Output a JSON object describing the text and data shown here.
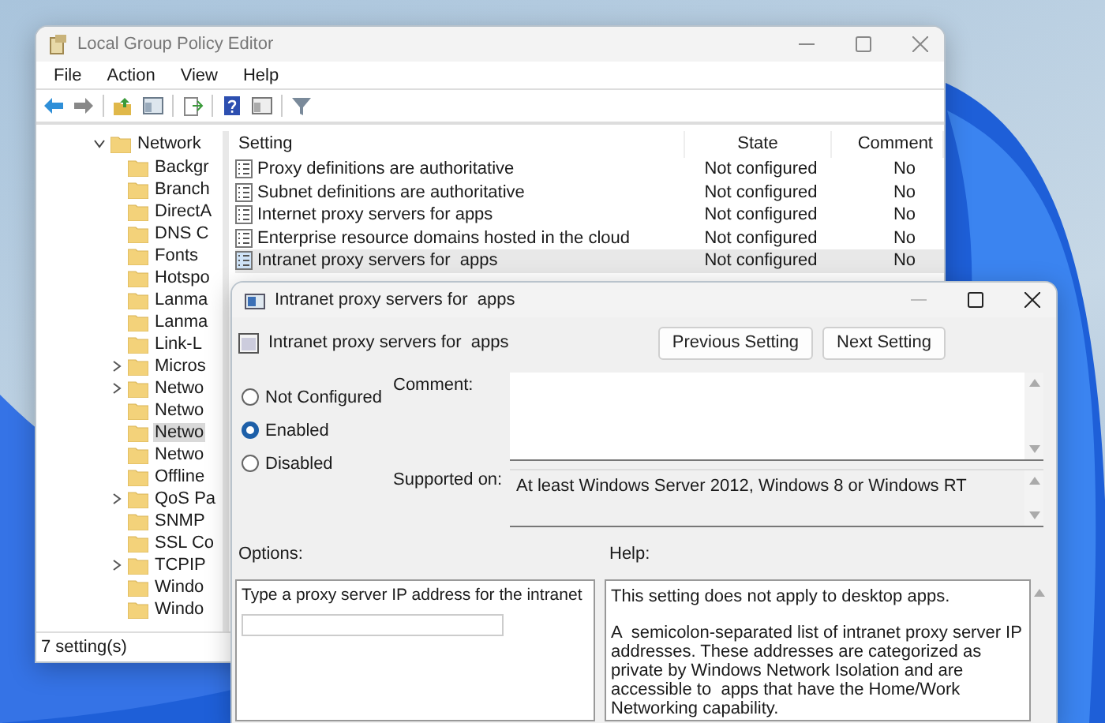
{
  "main_window": {
    "title": "Local Group Policy Editor",
    "menu": [
      "File",
      "Action",
      "View",
      "Help"
    ],
    "tree": {
      "label": "Network",
      "expanded": true,
      "children": [
        {
          "label": "Backgr",
          "kind": "leaf",
          "selected": false
        },
        {
          "label": "Branch",
          "kind": "leaf",
          "selected": false
        },
        {
          "label": "DirectA",
          "kind": "leaf",
          "selected": false
        },
        {
          "label": "DNS C",
          "kind": "leaf",
          "selected": false
        },
        {
          "label": "Fonts",
          "kind": "leaf",
          "selected": false
        },
        {
          "label": "Hotspo",
          "kind": "leaf",
          "selected": false
        },
        {
          "label": "Lanma",
          "kind": "leaf",
          "selected": false
        },
        {
          "label": "Lanma",
          "kind": "leaf",
          "selected": false
        },
        {
          "label": "Link-L",
          "kind": "leaf",
          "selected": false
        },
        {
          "label": "Micros",
          "kind": "collapsed",
          "selected": false
        },
        {
          "label": "Netwo",
          "kind": "collapsed",
          "selected": false
        },
        {
          "label": "Netwo",
          "kind": "leaf",
          "selected": false
        },
        {
          "label": "Netwo",
          "kind": "leaf",
          "selected": true
        },
        {
          "label": "Netwo",
          "kind": "leaf",
          "selected": false
        },
        {
          "label": "Offline",
          "kind": "leaf",
          "selected": false
        },
        {
          "label": "QoS Pa",
          "kind": "collapsed",
          "selected": false
        },
        {
          "label": "SNMP",
          "kind": "leaf",
          "selected": false
        },
        {
          "label": "SSL Co",
          "kind": "leaf",
          "selected": false
        },
        {
          "label": "TCPIP",
          "kind": "collapsed",
          "selected": false
        },
        {
          "label": "Windo",
          "kind": "leaf",
          "selected": false
        },
        {
          "label": "Windo",
          "kind": "leaf",
          "selected": false
        }
      ]
    },
    "table": {
      "columns": [
        "Setting",
        "State",
        "Comment"
      ],
      "rows": [
        {
          "setting": "Proxy definitions are authoritative",
          "state": "Not configured",
          "comment": "No",
          "selected": false
        },
        {
          "setting": "Subnet definitions are authoritative",
          "state": "Not configured",
          "comment": "No",
          "selected": false
        },
        {
          "setting": "Internet proxy servers for apps",
          "state": "Not configured",
          "comment": "No",
          "selected": false
        },
        {
          "setting": "Enterprise resource domains hosted in the cloud",
          "state": "Not configured",
          "comment": "No",
          "selected": false
        },
        {
          "setting": "Intranet proxy servers for  apps",
          "state": "Not configured",
          "comment": "No",
          "selected": true
        }
      ]
    },
    "status_bar": "7 setting(s)"
  },
  "dialog": {
    "title": "Intranet proxy servers for  apps",
    "heading": "Intranet proxy servers for  apps",
    "buttons": [
      "Previous Setting",
      "Next Setting"
    ],
    "options": [
      {
        "label": "Not Configured",
        "selected": false
      },
      {
        "label": "Enabled",
        "selected": true
      },
      {
        "label": "Disabled",
        "selected": false
      }
    ],
    "comment_label": "Comment:",
    "supported_label": "Supported on:",
    "supported_value": "At least Windows Server 2012, Windows 8 or Windows RT",
    "options_label": "Options:",
    "help_label": "Help:",
    "option_prompt": "Type a proxy server IP address for the intranet",
    "help_text": [
      "This setting does not apply to desktop apps.",
      "A  semicolon-separated list of intranet proxy server IP addresses. These addresses are categorized as private by Windows Network Isolation and are accessible to  apps that have the Home/Work Networking capability."
    ]
  }
}
